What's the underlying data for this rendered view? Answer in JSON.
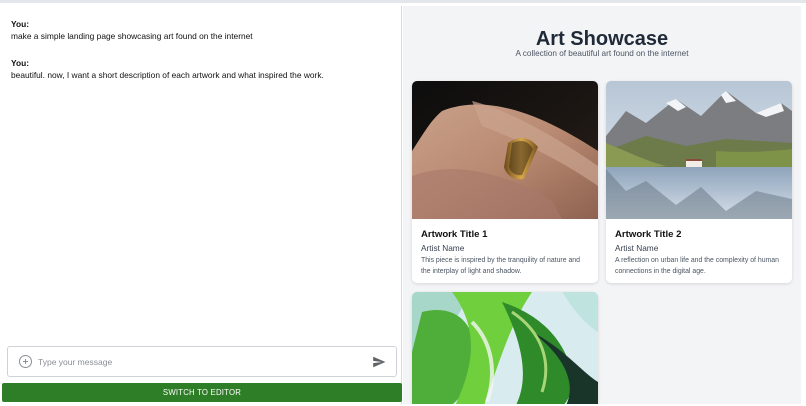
{
  "chat": {
    "messages": [
      {
        "sender": "You:",
        "text": "make a simple landing page showcasing art found on the internet"
      },
      {
        "sender": "You:",
        "text": "beautiful. now, I want a short description of each artwork and what inspired the work."
      }
    ],
    "composer": {
      "placeholder": "Type your message",
      "plus_icon": "plus-circle-icon",
      "send_icon": "send-icon"
    },
    "switch_button": "SWITCH TO EDITOR"
  },
  "preview": {
    "title": "Art Showcase",
    "subtitle": "A collection of beautiful art found on the internet",
    "cards": [
      {
        "title": "Artwork Title 1",
        "artist": "Artist Name",
        "description": "This piece is inspired by the tranquility of nature and the interplay of light and shadow."
      },
      {
        "title": "Artwork Title 2",
        "artist": "Artist Name",
        "description": "A reflection on urban life and the complexity of human connections in the digital age."
      },
      {
        "title": "",
        "artist": "",
        "description": ""
      }
    ]
  },
  "colors": {
    "accent_green": "#2e7d27",
    "preview_bg": "#f3f4f6",
    "title_text": "#1f2937"
  }
}
